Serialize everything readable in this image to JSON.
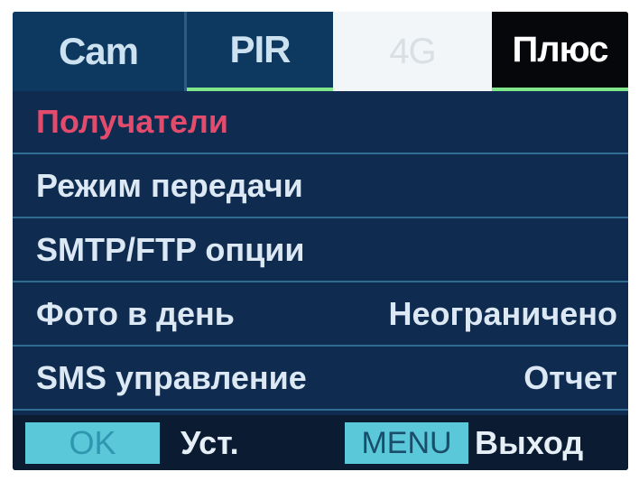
{
  "tabs": [
    "Cam",
    "PIR",
    "4G",
    "Плюс"
  ],
  "menu": {
    "items": [
      {
        "label": "Получатели",
        "value": ""
      },
      {
        "label": "Режим передачи",
        "value": ""
      },
      {
        "label": "SMTP/FTP опции",
        "value": ""
      },
      {
        "label": "Фото в день",
        "value": "Неограничено"
      },
      {
        "label": "SMS управление",
        "value": "Отчет"
      }
    ]
  },
  "footer": {
    "ok_button": "OK",
    "ok_action": "Уст.",
    "menu_button": "MENU",
    "menu_action": "Выход"
  },
  "colors": {
    "background": "#0f2c50",
    "active_item": "#e34b6c",
    "button": "#5bc8da",
    "tab_active": "#f2f6f8"
  }
}
